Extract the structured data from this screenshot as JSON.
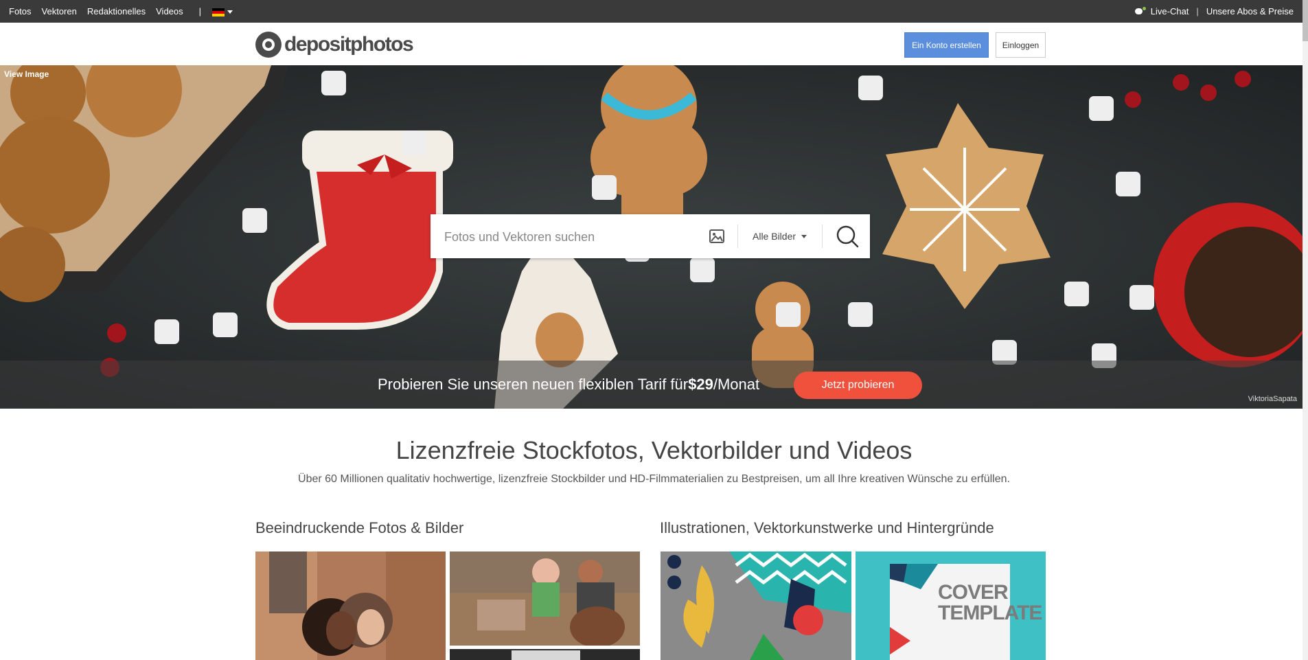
{
  "topbar": {
    "nav": [
      "Fotos",
      "Vektoren",
      "Redaktionelles",
      "Videos"
    ],
    "separator": "|",
    "language_flag": "german-flag-icon",
    "live_chat": "Live-Chat",
    "divider": "|",
    "plans": "Unsere Abos & Preise"
  },
  "header": {
    "logo_text": "depositphotos",
    "create_account": "Ein Konto erstellen",
    "login": "Einloggen"
  },
  "hero": {
    "view_image": "View Image",
    "search_placeholder": "Fotos und Vektoren suchen",
    "search_scope": "Alle Bilder",
    "promo_text_before": "Probieren Sie unseren neuen flexiblen Tarif für ",
    "promo_price": "$29",
    "promo_text_after": "/Monat",
    "promo_button": "Jetzt probieren",
    "credit": "ViktoriaSapata"
  },
  "main": {
    "title": "Lizenzfreie Stockfotos, Vektorbilder und Videos",
    "subtitle": "Über 60 Millionen qualitativ hochwertige, lizenzfreie Stockbilder und HD-Filmmaterialien zu Bestpreisen, um all Ihre kreativen Wünsche zu erfüllen.",
    "section_photos": "Beeindruckende Fotos & Bilder",
    "section_vectors": "Illustrationen, Vektorkunstwerke und Hintergründe",
    "cover_line1": "COVER",
    "cover_line2": "TEMPLATE"
  },
  "colors": {
    "topbar": "#3a3a3a",
    "create_button": "#5b8fdd",
    "promo_button": "#f0513d"
  }
}
